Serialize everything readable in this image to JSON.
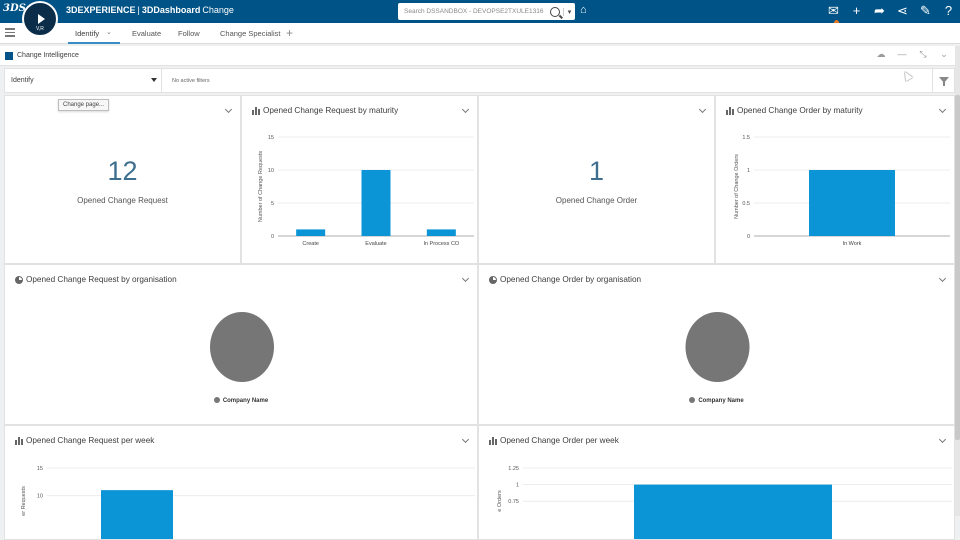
{
  "topbar": {
    "logo": "3DS",
    "compass_version": "V,R",
    "brand_prefix": "3DEXPERIENCE",
    "brand_separator": "|",
    "brand_product": "3DDashboard",
    "brand_app": "Change",
    "search_placeholder": "Search DSSANDBOX - DEVOPSE2TXULE1316",
    "notification_count": "3",
    "icons": [
      "tag-icon",
      "notification-icon",
      "add-icon",
      "share-icon",
      "network-icon",
      "compass-tool-icon",
      "help-icon"
    ]
  },
  "tabs": [
    {
      "label": "Identify",
      "active": true
    },
    {
      "label": "Evaluate",
      "active": false
    },
    {
      "label": "Follow",
      "active": false
    },
    {
      "label": "Change Specialist",
      "active": false
    }
  ],
  "widget": {
    "title": "Change Intelligence",
    "filter_value": "Identify",
    "filter_status": "No active filters",
    "tooltip": "Change page..."
  },
  "cards": {
    "cr_count": {
      "value": "12",
      "label": "Opened Change Request"
    },
    "cr_maturity": {
      "title": "Opened Change Request by maturity"
    },
    "co_count": {
      "value": "1",
      "label": "Opened Change Order"
    },
    "co_maturity": {
      "title": "Opened Change Order by maturity"
    },
    "cr_org": {
      "title": "Opened Change Request by organisation",
      "legend": "Company Name"
    },
    "co_org": {
      "title": "Opened Change Order by organisation",
      "legend": "Company Name"
    },
    "cr_week": {
      "title": "Opened Change Request per week"
    },
    "co_week": {
      "title": "Opened Change Order per week"
    }
  },
  "colors": {
    "topbar": "#005386",
    "bar": "#0b95d6",
    "pie": "#767676"
  },
  "chart_data": [
    {
      "type": "bar",
      "title": "Opened Change Request by maturity",
      "ylabel": "Number of Change Requests",
      "categories": [
        "Create",
        "Evaluate",
        "In Process CO"
      ],
      "values": [
        1,
        10,
        1
      ],
      "yticks": [
        "0",
        "5",
        "10",
        "15"
      ],
      "ylim": [
        0,
        15
      ]
    },
    {
      "type": "bar",
      "title": "Opened Change Order by maturity",
      "ylabel": "Number of Change Orders",
      "categories": [
        "In Work"
      ],
      "values": [
        1
      ],
      "yticks": [
        "0",
        "0.5",
        "1",
        "1.5"
      ],
      "ylim": [
        0,
        1.5
      ]
    },
    {
      "type": "pie",
      "title": "Opened Change Request by organisation",
      "categories": [
        "Company Name"
      ],
      "values": [
        12
      ]
    },
    {
      "type": "pie",
      "title": "Opened Change Order by organisation",
      "categories": [
        "Company Name"
      ],
      "values": [
        1
      ]
    },
    {
      "type": "bar",
      "title": "Opened Change Request per week",
      "ylabel": "Number of Change Requests",
      "ylabel_visible": "er Requests",
      "values": [
        11
      ],
      "yticks": [
        "10",
        "15"
      ],
      "ylim": [
        0,
        15
      ]
    },
    {
      "type": "bar",
      "title": "Opened Change Order per week",
      "ylabel": "Number of Change Orders",
      "ylabel_visible": "e Orders",
      "values": [
        1
      ],
      "yticks": [
        "0.75",
        "1",
        "1.25"
      ],
      "ylim": [
        0,
        1.25
      ]
    }
  ]
}
